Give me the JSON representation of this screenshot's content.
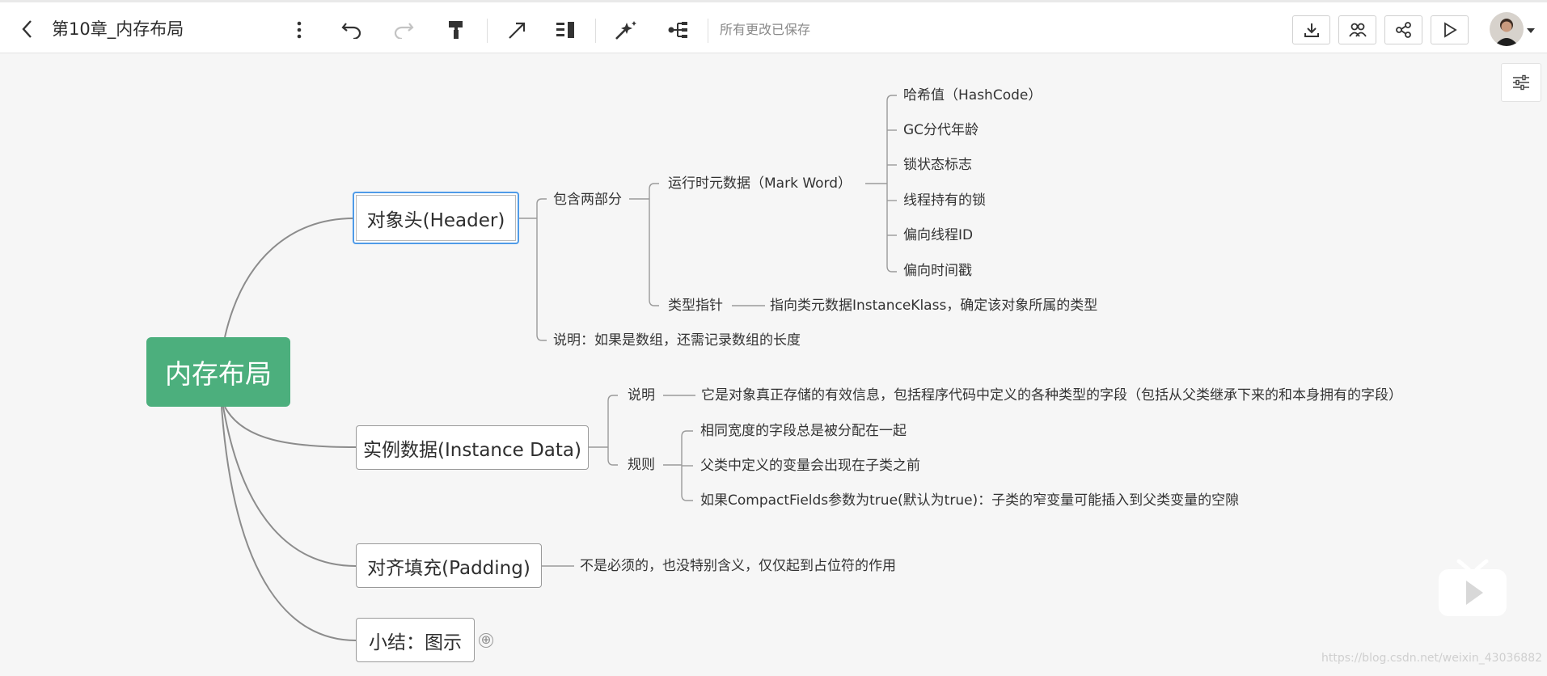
{
  "toolbar": {
    "title": "第10章_内存布局",
    "save_status": "所有更改已保存"
  },
  "mindmap": {
    "root": "内存布局",
    "header": {
      "label": "对象头(Header)",
      "part_label": "包含两部分",
      "mark_word": {
        "label": "运行时元数据（Mark Word）",
        "items": [
          "哈希值（HashCode）",
          "GC分代年龄",
          "锁状态标志",
          "线程持有的锁",
          "偏向线程ID",
          "偏向时间戳"
        ]
      },
      "type_pointer": {
        "label": "类型指针",
        "desc": "指向类元数据InstanceKlass，确定该对象所属的类型"
      },
      "note": "说明：如果是数组，还需记录数组的长度"
    },
    "instance": {
      "label": "实例数据(Instance Data)",
      "desc_label": "说明",
      "desc": "它是对象真正存储的有效信息，包括程序代码中定义的各种类型的字段（包括从父类继承下来的和本身拥有的字段）",
      "rules_label": "规则",
      "rules": [
        "相同宽度的字段总是被分配在一起",
        "父类中定义的变量会出现在子类之前",
        "如果CompactFields参数为true(默认为true)：子类的窄变量可能插入到父类变量的空隙"
      ]
    },
    "padding": {
      "label": "对齐填充(Padding)",
      "desc": "不是必须的，也没特别含义，仅仅起到占位符的作用"
    },
    "summary": {
      "label": "小结：图示",
      "plus": "⊕"
    }
  },
  "watermark": "https://blog.csdn.net/weixin_43036882",
  "colors": {
    "root": "#4caf7d",
    "selection": "#4f9be8",
    "line": "#8c8c8c"
  }
}
